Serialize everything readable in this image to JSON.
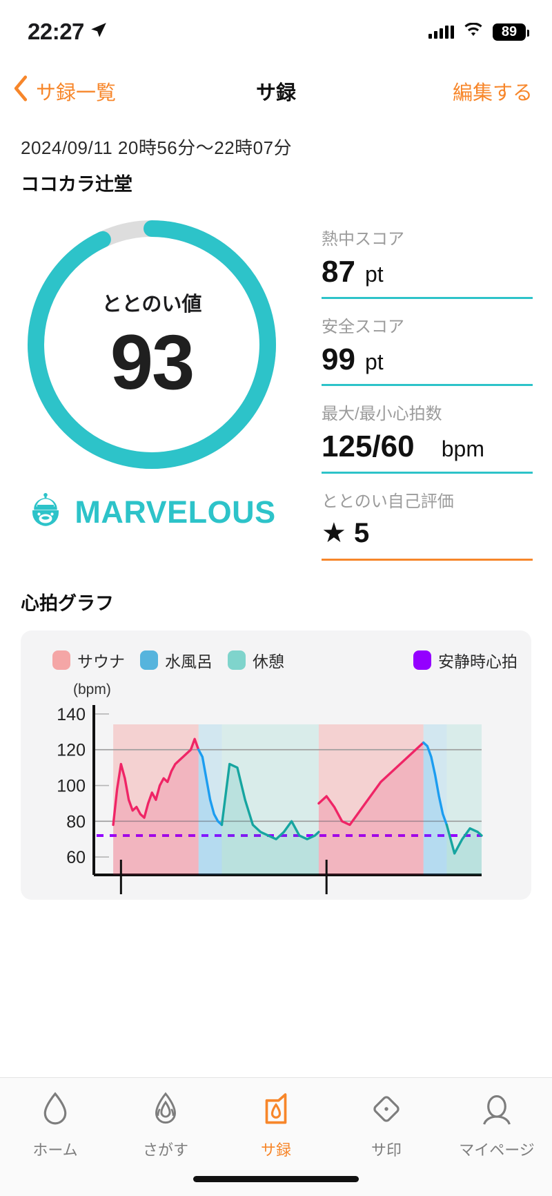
{
  "status_bar": {
    "time": "22:27",
    "location_icon": "location-arrow-icon",
    "signal_icon": "cellular-bars-icon",
    "wifi_icon": "wifi-icon",
    "battery_level": "89"
  },
  "nav": {
    "back_label": "サ録一覧",
    "back_icon": "chevron-left-icon",
    "title": "サ録",
    "edit_label": "編集する"
  },
  "header": {
    "date_range": "2024/09/11 20時56分〜22時07分",
    "venue": "ココカラ辻堂"
  },
  "gauge": {
    "label": "ととのい値",
    "value": "93",
    "percent": 93,
    "track_color": "#dddddd",
    "fill_color": "#2dc3c9",
    "rank_text": "MARVELOUS",
    "rank_icon": "sauna-hat-face-icon"
  },
  "stats": [
    {
      "label": "熱中スコア",
      "value": "87",
      "unit": "pt",
      "rule_color": "#2dc3c9"
    },
    {
      "label": "安全スコア",
      "value": "99",
      "unit": "pt",
      "rule_color": "#2dc3c9"
    },
    {
      "label": "最大/最小心拍数",
      "value": "125/60",
      "unit": "bpm",
      "rule_color": "#2dc3c9"
    },
    {
      "label": "ととのい自己評価",
      "value": "★ 5",
      "unit": "",
      "rule_color": "#f7862a"
    }
  ],
  "chart_section": {
    "title": "心拍グラフ",
    "legend": [
      {
        "label": "サウナ",
        "color": "#f4a6a6"
      },
      {
        "label": "水風呂",
        "color": "#56b4dd"
      },
      {
        "label": "休憩",
        "color": "#7fd4cc"
      },
      {
        "label": "安静時心拍",
        "color": "#9400ff"
      }
    ]
  },
  "chart_data": {
    "type": "line",
    "title": "心拍グラフ",
    "xlabel": "",
    "ylabel": "(bpm)",
    "ylim": [
      50,
      145
    ],
    "yticks": [
      60,
      80,
      100,
      120,
      140
    ],
    "gridlines": [
      80,
      120
    ],
    "grid": true,
    "legend_position": "top",
    "resting_hr": 72,
    "resting_hr_style": "dashed",
    "resting_hr_color": "#9400ff",
    "phases": [
      {
        "name": "サウナ",
        "color": "#f4a6a6",
        "start_pct": 5,
        "end_pct": 27
      },
      {
        "name": "水風呂",
        "color": "#a9d8ec",
        "start_pct": 27,
        "end_pct": 33
      },
      {
        "name": "休憩",
        "color": "#b9e3dd",
        "start_pct": 33,
        "end_pct": 58
      },
      {
        "name": "サウナ",
        "color": "#f4a6a6",
        "start_pct": 58,
        "end_pct": 85
      },
      {
        "name": "水風呂",
        "color": "#a9d8ec",
        "start_pct": 85,
        "end_pct": 91
      },
      {
        "name": "休憩",
        "color": "#b9e3dd",
        "start_pct": 91,
        "end_pct": 100
      }
    ],
    "series": [
      {
        "name": "サウナ心拍",
        "color": "#ef2566",
        "x": [
          5,
          6,
          7,
          8,
          9,
          10,
          11,
          12,
          13,
          14,
          15,
          16,
          17,
          18,
          19,
          20,
          21,
          22,
          23,
          24,
          25,
          26,
          27
        ],
        "values": [
          78,
          98,
          112,
          104,
          92,
          86,
          88,
          84,
          82,
          90,
          96,
          92,
          100,
          104,
          102,
          108,
          112,
          114,
          116,
          118,
          120,
          126,
          120
        ]
      },
      {
        "name": "水風呂心拍",
        "color": "#1c9df0",
        "x": [
          27,
          28,
          29,
          30,
          31,
          32,
          33
        ],
        "values": [
          120,
          116,
          104,
          92,
          84,
          80,
          78
        ]
      },
      {
        "name": "休憩心拍",
        "color": "#16a5a0",
        "x": [
          33,
          35,
          37,
          39,
          41,
          43,
          45,
          47,
          49,
          51,
          53,
          55,
          57,
          58
        ],
        "values": [
          78,
          112,
          110,
          92,
          78,
          74,
          72,
          70,
          74,
          80,
          72,
          70,
          72,
          74
        ]
      },
      {
        "name": "サウナ心拍2",
        "color": "#ef2566",
        "x": [
          58,
          60,
          62,
          64,
          66,
          68,
          70,
          72,
          74,
          76,
          78,
          80,
          82,
          84,
          85
        ],
        "values": [
          90,
          94,
          88,
          80,
          78,
          84,
          90,
          96,
          102,
          106,
          110,
          114,
          118,
          122,
          124
        ]
      },
      {
        "name": "水風呂心拍2",
        "color": "#1c9df0",
        "x": [
          85,
          86,
          87,
          88,
          89,
          90,
          91
        ],
        "values": [
          124,
          122,
          116,
          106,
          94,
          84,
          78
        ]
      },
      {
        "name": "休憩心拍2",
        "color": "#16a5a0",
        "x": [
          91,
          93,
          95,
          97,
          99,
          100
        ],
        "values": [
          78,
          62,
          70,
          76,
          74,
          72
        ]
      }
    ],
    "markers": [
      {
        "type": "tick",
        "x_pct": 7
      },
      {
        "type": "tick",
        "x_pct": 60
      }
    ]
  },
  "tabbar": {
    "tabs": [
      {
        "label": "ホーム",
        "icon": "water-drop-icon",
        "active": false
      },
      {
        "label": "さがす",
        "icon": "flame-search-icon",
        "active": false
      },
      {
        "label": "サ録",
        "icon": "record-flame-icon",
        "active": true
      },
      {
        "label": "サ印",
        "icon": "diamond-stamp-icon",
        "active": false
      },
      {
        "label": "マイページ",
        "icon": "person-icon",
        "active": false
      }
    ]
  },
  "theme": {
    "accent_orange": "#f7862a",
    "accent_teal": "#2dc3c9",
    "text_primary": "#111111",
    "text_muted": "#9b9b9b"
  }
}
